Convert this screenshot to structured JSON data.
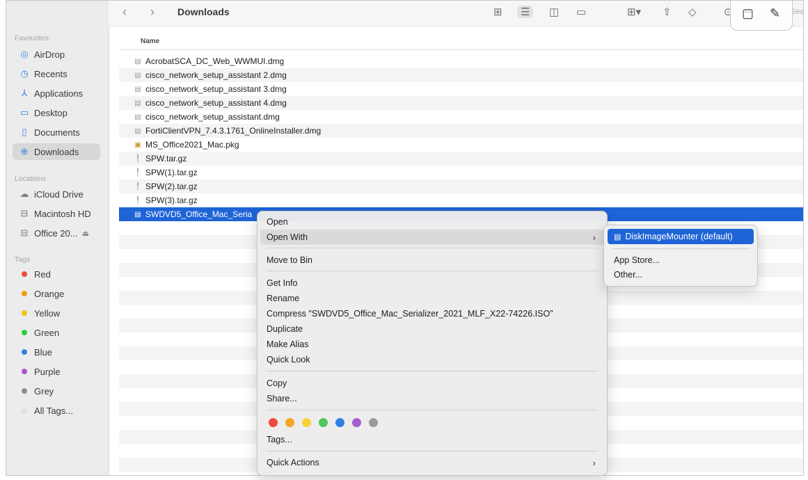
{
  "toolbar": {
    "back_icon": "chevron-left-icon",
    "forward_icon": "chevron-right-icon",
    "title": "Downloads",
    "search_placeholder": "Sea"
  },
  "sidebar": {
    "favourites_heading": "Favourites",
    "favourites": [
      {
        "label": "AirDrop",
        "icon": "airdrop-icon"
      },
      {
        "label": "Recents",
        "icon": "clock-icon"
      },
      {
        "label": "Applications",
        "icon": "applications-icon"
      },
      {
        "label": "Desktop",
        "icon": "desktop-icon"
      },
      {
        "label": "Documents",
        "icon": "document-icon"
      },
      {
        "label": "Downloads",
        "icon": "download-icon"
      }
    ],
    "locations_heading": "Locations",
    "locations": [
      {
        "label": "iCloud Drive",
        "icon": "cloud-icon"
      },
      {
        "label": "Macintosh HD",
        "icon": "drive-icon"
      },
      {
        "label": "Office 20...",
        "icon": "drive-icon",
        "eject": "⏏"
      }
    ],
    "tags_heading": "Tags",
    "tags": [
      {
        "label": "Red",
        "color": "#e74c3c"
      },
      {
        "label": "Orange",
        "color": "#f39c12"
      },
      {
        "label": "Yellow",
        "color": "#f1c40f"
      },
      {
        "label": "Green",
        "color": "#2ecc40"
      },
      {
        "label": "Blue",
        "color": "#2f7fe0"
      },
      {
        "label": "Purple",
        "color": "#a757c9"
      },
      {
        "label": "Grey",
        "color": "#8e8e8e"
      }
    ],
    "all_tags": "All Tags..."
  },
  "list": {
    "column_name": "Name",
    "files": [
      "AcrobatSCA_DC_Web_WWMUI.dmg",
      "cisco_network_setup_assistant 2.dmg",
      "cisco_network_setup_assistant 3.dmg",
      "cisco_network_setup_assistant 4.dmg",
      "cisco_network_setup_assistant.dmg",
      "FortiClientVPN_7.4.3.1761_OnlineInstaller.dmg",
      "MS_Office2021_Mac.pkg",
      "SPW.tar.gz",
      "SPW(1).tar.gz",
      "SPW(2).tar.gz",
      "SPW(3).tar.gz",
      "SWDVD5_Office_Mac_Seria"
    ]
  },
  "context_menu": {
    "open": "Open",
    "open_with": "Open With",
    "move_to_bin": "Move to Bin",
    "get_info": "Get Info",
    "rename": "Rename",
    "compress": "Compress \"SWDVD5_Office_Mac_Serializer_2021_MLF_X22-74226.ISO\"",
    "duplicate": "Duplicate",
    "make_alias": "Make Alias",
    "quick_look": "Quick Look",
    "copy": "Copy",
    "share": "Share...",
    "tag_colors": [
      "#ef4a3c",
      "#f5a623",
      "#f7d23a",
      "#4fc95c",
      "#2f7fe0",
      "#a55fd0",
      "#9a9a9a"
    ],
    "tags": "Tags...",
    "quick_actions": "Quick Actions"
  },
  "submenu": {
    "default_app": "DiskImageMounter (default)",
    "app_store": "App Store...",
    "other": "Other..."
  }
}
